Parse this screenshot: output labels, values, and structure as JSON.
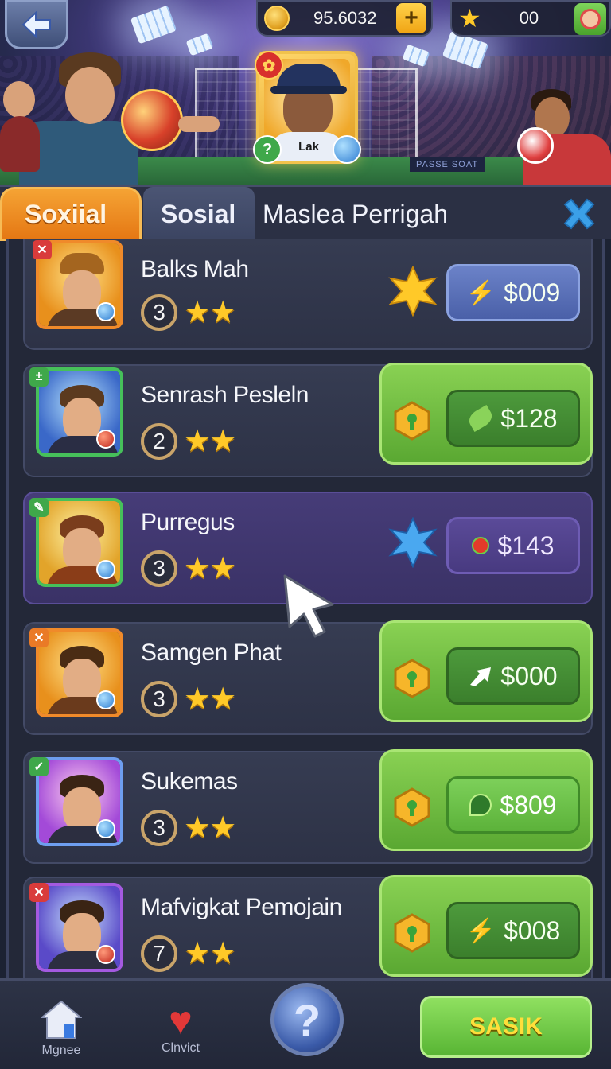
{
  "header": {
    "coins": "95.6032",
    "stars": "00",
    "featured_player_name": "Lak",
    "banner_text": "PASSE SOAT"
  },
  "tabs": [
    {
      "label": "Soxiial",
      "active": true
    },
    {
      "label": "Sosial",
      "active": false
    },
    {
      "label": "Maslea Perrigah",
      "active": false
    }
  ],
  "players": [
    {
      "name": "Balks Mah",
      "level": "3",
      "stars": 2,
      "price": "$009",
      "price_style": "blue",
      "tray": false,
      "icon": "star-burst-icon"
    },
    {
      "name": "Senrash Pesleln",
      "level": "2",
      "stars": 2,
      "price": "$128",
      "price_style": "green",
      "tray": true,
      "icon": "hex-gem-icon"
    },
    {
      "name": "Purregus",
      "level": "3",
      "stars": 2,
      "price": "$143",
      "price_style": "purple",
      "tray": false,
      "icon": "blue-burst-icon"
    },
    {
      "name": "Samgen Phat",
      "level": "3",
      "stars": 2,
      "price": "$000",
      "price_style": "green",
      "tray": true,
      "icon": "hex-gem-icon"
    },
    {
      "name": "Sukemas",
      "level": "3",
      "stars": 2,
      "price": "$809",
      "price_style": "lightgreen",
      "tray": true,
      "icon": "hex-gem-icon"
    },
    {
      "name": "Mafvigkat Pemojain",
      "level": "7",
      "stars": 2,
      "price": "$008",
      "price_style": "green",
      "tray": true,
      "icon": "hex-gem-icon"
    }
  ],
  "bottom_nav": {
    "home_label": "Mgnee",
    "fav_label": "Clnvict",
    "action_label": "SASIK"
  },
  "colors": {
    "accent_orange": "#f5a334",
    "green": "#6dbf3f",
    "star": "#ffc928"
  }
}
